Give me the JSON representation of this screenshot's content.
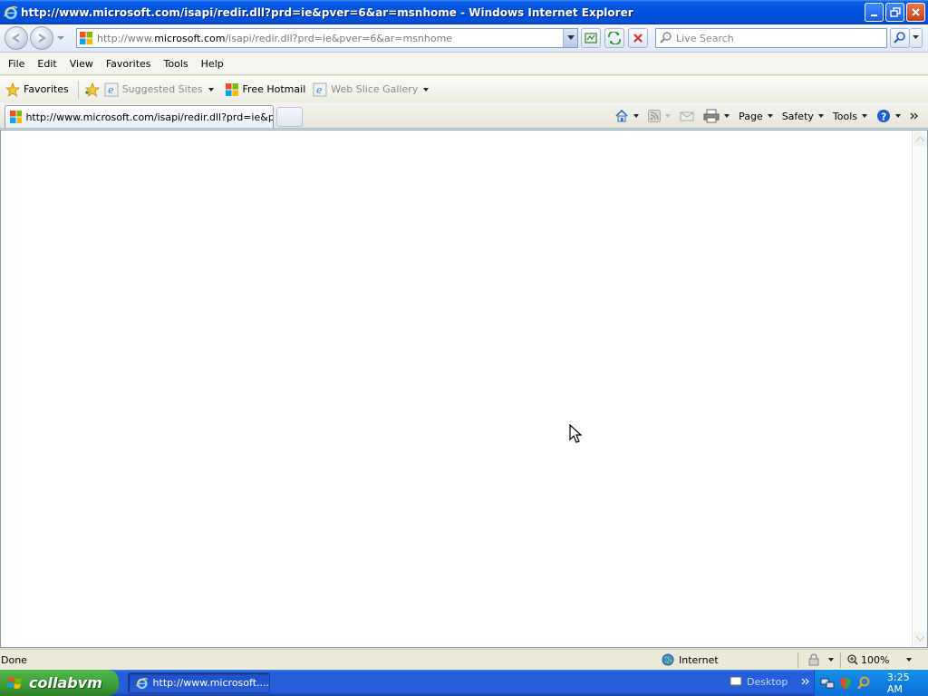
{
  "window": {
    "title": "http://www.microsoft.com/isapi/redir.dll?prd=ie&pver=6&ar=msnhome - Windows Internet Explorer"
  },
  "address_bar": {
    "url_prefix": "http://www.",
    "url_domain": "microsoft.com",
    "url_path": "/isapi/redir.dll?prd=ie&pver=6&ar=msnhome",
    "search_placeholder": "Live Search"
  },
  "menu": {
    "items": [
      "File",
      "Edit",
      "View",
      "Favorites",
      "Tools",
      "Help"
    ]
  },
  "favorites_bar": {
    "favorites_label": "Favorites",
    "items": [
      {
        "label": "Suggested Sites",
        "dimmed": true
      },
      {
        "label": "Free Hotmail",
        "dimmed": false
      },
      {
        "label": "Web Slice Gallery",
        "dimmed": true
      }
    ]
  },
  "tabs": [
    {
      "title": "http://www.microsoft.com/isapi/redir.dll?prd=ie&pver...",
      "active": true
    }
  ],
  "command_bar": {
    "page": "Page",
    "safety": "Safety",
    "tools": "Tools"
  },
  "status_bar": {
    "status": "Done",
    "zone": "Internet",
    "zoom": "100%"
  },
  "taskbar": {
    "start_label": "collabvm",
    "task_label": "http://www.microsoft....",
    "desktop_label": "Desktop",
    "clock": "3:25 AM"
  },
  "colors": {
    "titlebar": "#0050d8",
    "taskbar": "#245edb",
    "start": "#3c9c36"
  }
}
